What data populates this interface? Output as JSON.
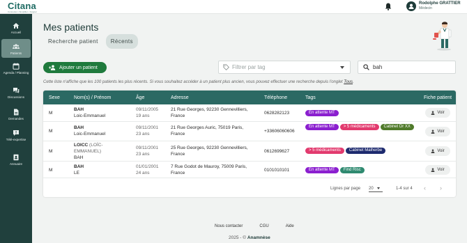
{
  "app": {
    "logo_text": "Citana",
    "logo_tagline": "Connecter • Simplifier • Soigner"
  },
  "user": {
    "name": "Rodolphe GRATTIER",
    "role": "Médecin"
  },
  "sidebar": {
    "items": [
      {
        "label": "Accueil",
        "icon": "home-icon"
      },
      {
        "label": "Patients",
        "icon": "patients-icon",
        "active": true
      },
      {
        "label": "Agenda / Planning",
        "icon": "calendar-icon"
      },
      {
        "label": "Discussions",
        "icon": "chat-icon"
      },
      {
        "label": "Demandes",
        "icon": "document-icon"
      },
      {
        "label": "Télé-expertise",
        "icon": "tele-expertise-icon"
      },
      {
        "label": "Annuaire",
        "icon": "directory-icon"
      }
    ]
  },
  "page": {
    "title": "Mes patients",
    "tabs": [
      {
        "label": "Recherche patient",
        "active": false
      },
      {
        "label": "Récents",
        "active": true
      }
    ],
    "add_patient_label": "Ajouter un patient",
    "tag_filter_placeholder": "Filtrer par tag",
    "search_value": "bah",
    "info_text": "Cette liste n'affiche que les 100 patients les plus récents. Si vous souhaitez accéder à un patient plus ancien, vous pouvez effectuer une recherche depuis l'onglet ",
    "info_link": "Tous",
    "info_end": "."
  },
  "table": {
    "headers": {
      "sexe": "Sexe",
      "nom": "Nom(s) / Prénom",
      "age": "Âge",
      "adresse": "Adresse",
      "telephone": "Téléphone",
      "tags": "Tags",
      "fiche": "Fiche patient"
    },
    "rows": [
      {
        "sexe": "M",
        "nom": "BAH",
        "nom_extra": "",
        "prenom": "Loic-Emmanuel",
        "dob": "09/11/2005",
        "age": "19 ans",
        "adresse": "21 Rue Georges, 92230 Gennevilliers, France",
        "telephone": "0628282123",
        "tags": [
          {
            "label": "En attente MT",
            "color": "#8b1fcf"
          }
        ],
        "voir": "Voir"
      },
      {
        "sexe": "M",
        "nom": "BAH",
        "nom_extra": "",
        "prenom": "Loic-Emmanuel",
        "dob": "09/11/2001",
        "age": "23 ans",
        "adresse": "21 Rue Georges Auric, 75019 Paris, France",
        "telephone": "+33606060606",
        "tags": [
          {
            "label": "En attente MT",
            "color": "#8b1fcf"
          },
          {
            "label": "> 5 médicaments",
            "color": "#e23a6e"
          },
          {
            "label": "Cabinet Dr XX",
            "color": "#4f7a2a"
          }
        ],
        "voir": "Voir"
      },
      {
        "sexe": "M",
        "nom": "LOICC",
        "nom_extra": " (LOÏC-EMMANUEL)",
        "prenom": "BAH",
        "dob": "09/11/2001",
        "age": "23 ans",
        "adresse": "25 Rue Georges, 92230 Gennevilliers, France",
        "telephone": "0612699627",
        "tags": [
          {
            "label": "> 5 médicaments",
            "color": "#e23a6e"
          },
          {
            "label": "Cabinet Malherbe",
            "color": "#1d2a6e"
          }
        ],
        "voir": "Voir"
      },
      {
        "sexe": "M",
        "nom": "BAH",
        "nom_extra": "",
        "prenom": "LE",
        "dob": "01/01/2001",
        "age": "24 ans",
        "adresse": "7 Rue Godot de Mauroy, 75009 Paris, France",
        "telephone": "0101010101",
        "tags": [
          {
            "label": "En attente MT",
            "color": "#8b1fcf"
          },
          {
            "label": "Find Risc",
            "color": "#2f8a70"
          }
        ],
        "voir": "Voir"
      }
    ],
    "pagination": {
      "rows_per_page_label": "Lignes par page",
      "rows_per_page": "20",
      "range": "1-4 sur 4"
    }
  },
  "footer": {
    "links": [
      "Nous contacter",
      "CGU",
      "Aide"
    ],
    "copyright": "2025 - ©",
    "brand": "Anamnèse"
  },
  "colors": {
    "sidebar_bg": "#20403d",
    "table_header_bg": "#2b6963",
    "add_button_bg": "#1f7a3d",
    "brand": "#1d6a62"
  }
}
